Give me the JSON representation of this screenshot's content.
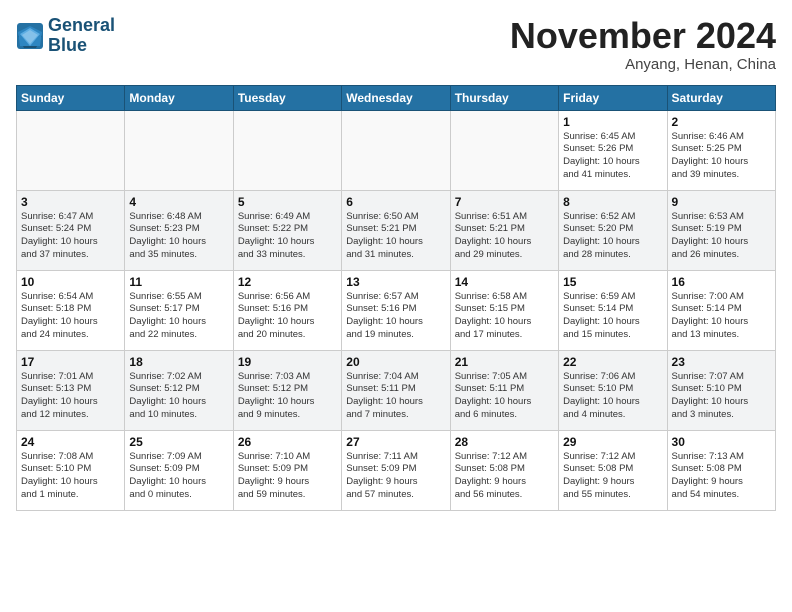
{
  "logo": {
    "line1": "General",
    "line2": "Blue"
  },
  "title": "November 2024",
  "location": "Anyang, Henan, China",
  "weekdays": [
    "Sunday",
    "Monday",
    "Tuesday",
    "Wednesday",
    "Thursday",
    "Friday",
    "Saturday"
  ],
  "weeks": [
    [
      {
        "day": "",
        "info": ""
      },
      {
        "day": "",
        "info": ""
      },
      {
        "day": "",
        "info": ""
      },
      {
        "day": "",
        "info": ""
      },
      {
        "day": "",
        "info": ""
      },
      {
        "day": "1",
        "info": "Sunrise: 6:45 AM\nSunset: 5:26 PM\nDaylight: 10 hours\nand 41 minutes."
      },
      {
        "day": "2",
        "info": "Sunrise: 6:46 AM\nSunset: 5:25 PM\nDaylight: 10 hours\nand 39 minutes."
      }
    ],
    [
      {
        "day": "3",
        "info": "Sunrise: 6:47 AM\nSunset: 5:24 PM\nDaylight: 10 hours\nand 37 minutes."
      },
      {
        "day": "4",
        "info": "Sunrise: 6:48 AM\nSunset: 5:23 PM\nDaylight: 10 hours\nand 35 minutes."
      },
      {
        "day": "5",
        "info": "Sunrise: 6:49 AM\nSunset: 5:22 PM\nDaylight: 10 hours\nand 33 minutes."
      },
      {
        "day": "6",
        "info": "Sunrise: 6:50 AM\nSunset: 5:21 PM\nDaylight: 10 hours\nand 31 minutes."
      },
      {
        "day": "7",
        "info": "Sunrise: 6:51 AM\nSunset: 5:21 PM\nDaylight: 10 hours\nand 29 minutes."
      },
      {
        "day": "8",
        "info": "Sunrise: 6:52 AM\nSunset: 5:20 PM\nDaylight: 10 hours\nand 28 minutes."
      },
      {
        "day": "9",
        "info": "Sunrise: 6:53 AM\nSunset: 5:19 PM\nDaylight: 10 hours\nand 26 minutes."
      }
    ],
    [
      {
        "day": "10",
        "info": "Sunrise: 6:54 AM\nSunset: 5:18 PM\nDaylight: 10 hours\nand 24 minutes."
      },
      {
        "day": "11",
        "info": "Sunrise: 6:55 AM\nSunset: 5:17 PM\nDaylight: 10 hours\nand 22 minutes."
      },
      {
        "day": "12",
        "info": "Sunrise: 6:56 AM\nSunset: 5:16 PM\nDaylight: 10 hours\nand 20 minutes."
      },
      {
        "day": "13",
        "info": "Sunrise: 6:57 AM\nSunset: 5:16 PM\nDaylight: 10 hours\nand 19 minutes."
      },
      {
        "day": "14",
        "info": "Sunrise: 6:58 AM\nSunset: 5:15 PM\nDaylight: 10 hours\nand 17 minutes."
      },
      {
        "day": "15",
        "info": "Sunrise: 6:59 AM\nSunset: 5:14 PM\nDaylight: 10 hours\nand 15 minutes."
      },
      {
        "day": "16",
        "info": "Sunrise: 7:00 AM\nSunset: 5:14 PM\nDaylight: 10 hours\nand 13 minutes."
      }
    ],
    [
      {
        "day": "17",
        "info": "Sunrise: 7:01 AM\nSunset: 5:13 PM\nDaylight: 10 hours\nand 12 minutes."
      },
      {
        "day": "18",
        "info": "Sunrise: 7:02 AM\nSunset: 5:12 PM\nDaylight: 10 hours\nand 10 minutes."
      },
      {
        "day": "19",
        "info": "Sunrise: 7:03 AM\nSunset: 5:12 PM\nDaylight: 10 hours\nand 9 minutes."
      },
      {
        "day": "20",
        "info": "Sunrise: 7:04 AM\nSunset: 5:11 PM\nDaylight: 10 hours\nand 7 minutes."
      },
      {
        "day": "21",
        "info": "Sunrise: 7:05 AM\nSunset: 5:11 PM\nDaylight: 10 hours\nand 6 minutes."
      },
      {
        "day": "22",
        "info": "Sunrise: 7:06 AM\nSunset: 5:10 PM\nDaylight: 10 hours\nand 4 minutes."
      },
      {
        "day": "23",
        "info": "Sunrise: 7:07 AM\nSunset: 5:10 PM\nDaylight: 10 hours\nand 3 minutes."
      }
    ],
    [
      {
        "day": "24",
        "info": "Sunrise: 7:08 AM\nSunset: 5:10 PM\nDaylight: 10 hours\nand 1 minute."
      },
      {
        "day": "25",
        "info": "Sunrise: 7:09 AM\nSunset: 5:09 PM\nDaylight: 10 hours\nand 0 minutes."
      },
      {
        "day": "26",
        "info": "Sunrise: 7:10 AM\nSunset: 5:09 PM\nDaylight: 9 hours\nand 59 minutes."
      },
      {
        "day": "27",
        "info": "Sunrise: 7:11 AM\nSunset: 5:09 PM\nDaylight: 9 hours\nand 57 minutes."
      },
      {
        "day": "28",
        "info": "Sunrise: 7:12 AM\nSunset: 5:08 PM\nDaylight: 9 hours\nand 56 minutes."
      },
      {
        "day": "29",
        "info": "Sunrise: 7:12 AM\nSunset: 5:08 PM\nDaylight: 9 hours\nand 55 minutes."
      },
      {
        "day": "30",
        "info": "Sunrise: 7:13 AM\nSunset: 5:08 PM\nDaylight: 9 hours\nand 54 minutes."
      }
    ]
  ]
}
